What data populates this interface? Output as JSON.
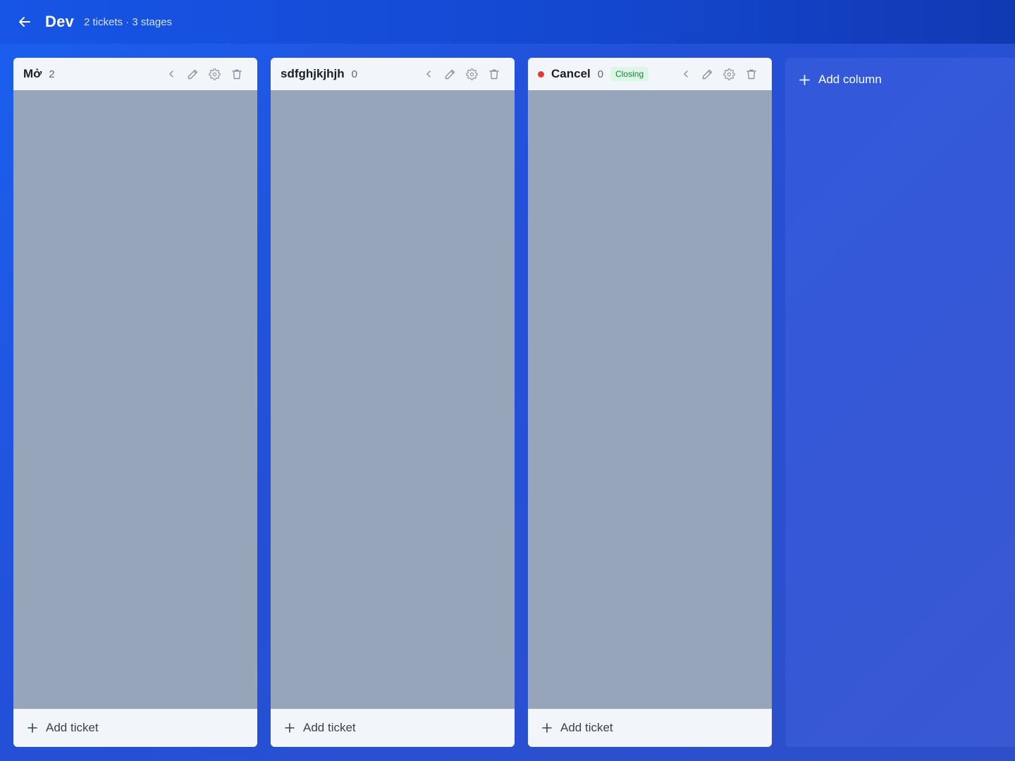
{
  "header": {
    "title": "Dev",
    "meta": "2 tickets · 3 stages"
  },
  "columns": [
    {
      "title": "Mở",
      "count": "2",
      "badge": "",
      "dot": false,
      "add_label": "Add ticket"
    },
    {
      "title": "sdfghjkjhjh",
      "count": "0",
      "badge": "",
      "dot": false,
      "add_label": "Add ticket"
    },
    {
      "title": "Cancel",
      "count": "0",
      "badge": "Closing",
      "dot": true,
      "dot_color": "#e5383b",
      "add_label": "Add ticket"
    }
  ],
  "add_column": {
    "label": "Add column"
  },
  "colors": {
    "background": "#1f56e0",
    "column_body": "#97a5ba",
    "column_header": "#f2f5f9",
    "badge_text": "#15803d",
    "badge_bg": "#dcf7e6"
  },
  "icons": {
    "back": "arrow-left-icon",
    "collapse": "chevron-left-icon",
    "edit": "pencil-icon",
    "settings": "gear-icon",
    "delete": "trash-icon",
    "add": "plus-icon"
  }
}
